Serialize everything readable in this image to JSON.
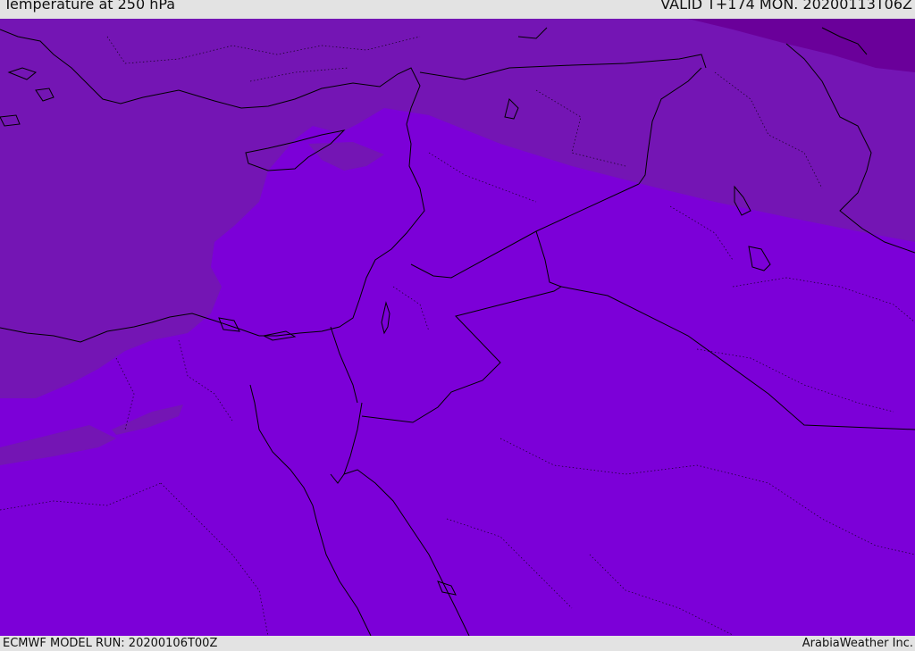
{
  "header": {
    "title": "Temperature at 250 hPa",
    "valid": "VALID T+174 MON. 20200113T06Z"
  },
  "footer": {
    "model_run": "ECMWF MODEL RUN: 20200106T00Z",
    "credit": "ArabiaWeather Inc."
  },
  "map": {
    "colors": {
      "warm_field": "#7c00d8",
      "mid_field": "#7415b4",
      "cold_field": "#6a009a",
      "coastline": "#000000",
      "border": "#000000"
    }
  }
}
